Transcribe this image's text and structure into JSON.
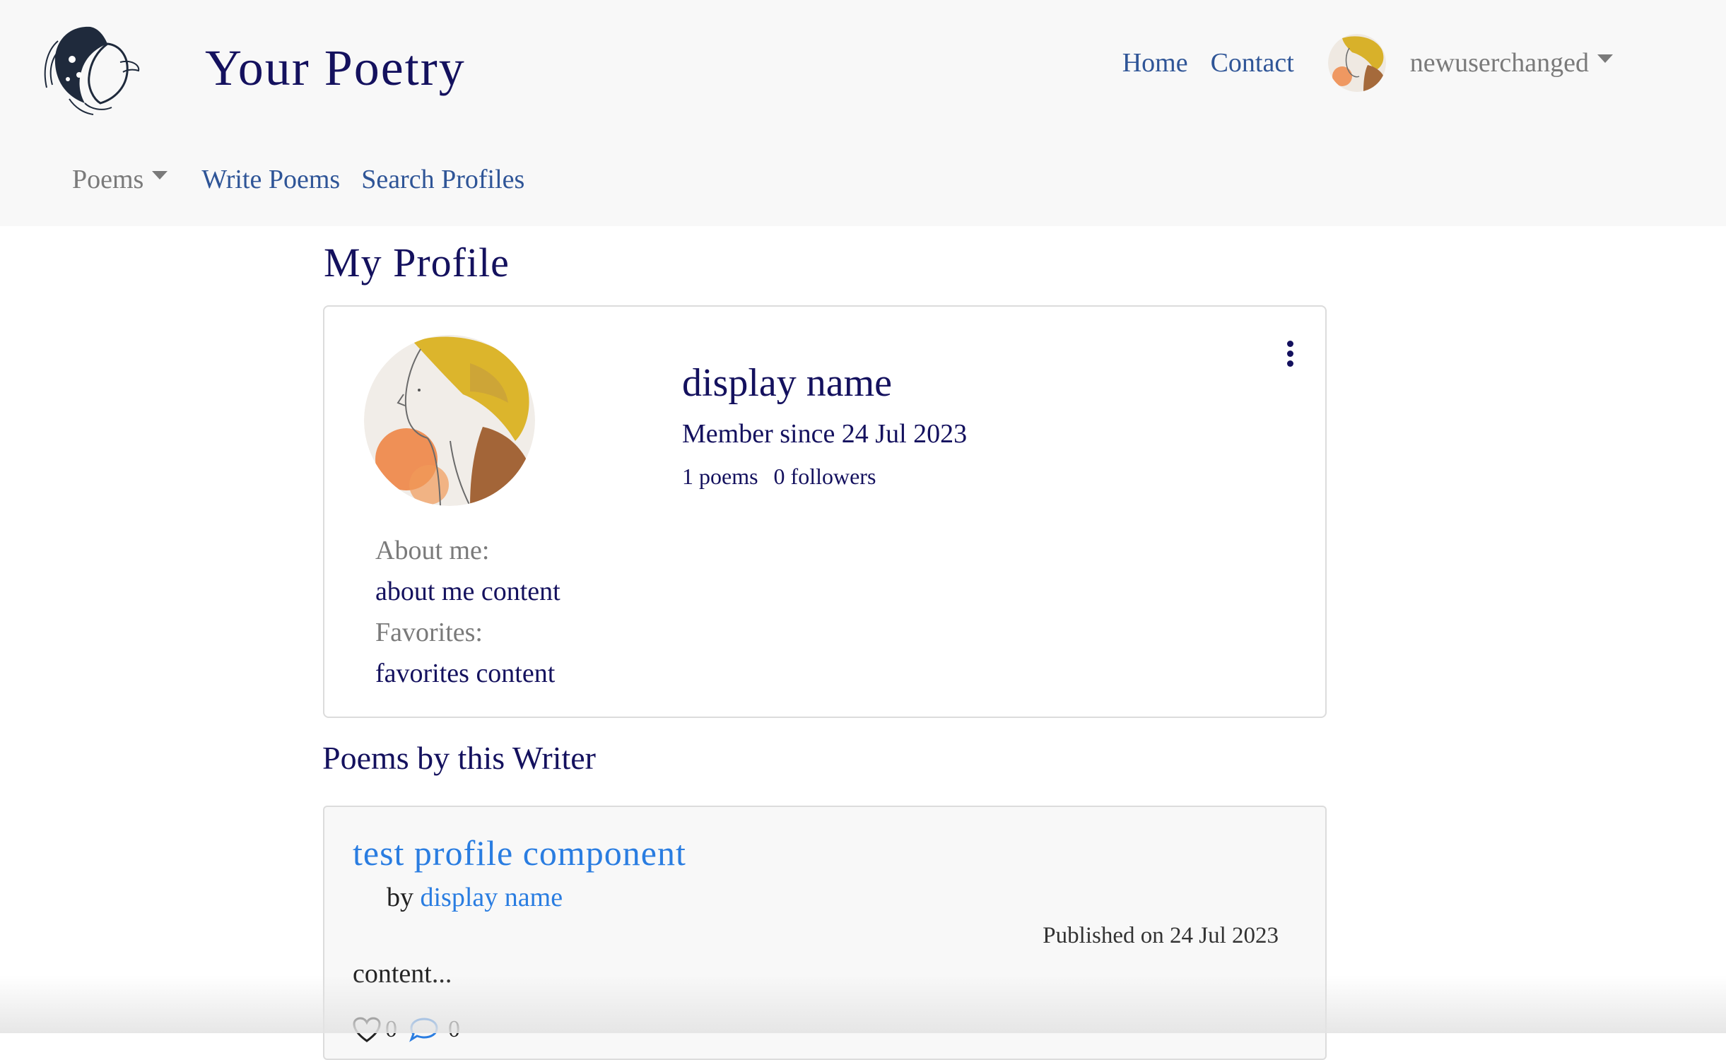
{
  "app": {
    "brand_title": "Your Poetry",
    "logo_icon": "woman-portrait-line-art-logo"
  },
  "nav": {
    "home": "Home",
    "contact": "Contact",
    "username": "newuserchanged",
    "poems_menu": "Poems",
    "write_poems": "Write Poems",
    "search_profiles": "Search Profiles"
  },
  "profile": {
    "page_title": "My Profile",
    "display_name": "display name",
    "member_since": "Member since 24 Jul 2023",
    "poems_count": "1 poems",
    "followers_count": "0 followers",
    "about_label": "About me:",
    "about_value": "about me content",
    "favorites_label": "Favorites:",
    "favorites_value": "favorites content",
    "menu_icon": "kebab-menu-icon"
  },
  "poems_section": {
    "title": "Poems by this Writer",
    "items": [
      {
        "title": "test profile component",
        "by_label": "by",
        "author": "display name",
        "published": "Published on 24 Jul 2023",
        "excerpt": "content...",
        "likes": "0",
        "comments": "0"
      }
    ]
  },
  "colors": {
    "navy": "#14115e",
    "link_blue": "#2f5597",
    "accent_blue": "#2a7de1",
    "navbar_bg": "#f8f8f8",
    "muted": "#7a7a7a"
  }
}
